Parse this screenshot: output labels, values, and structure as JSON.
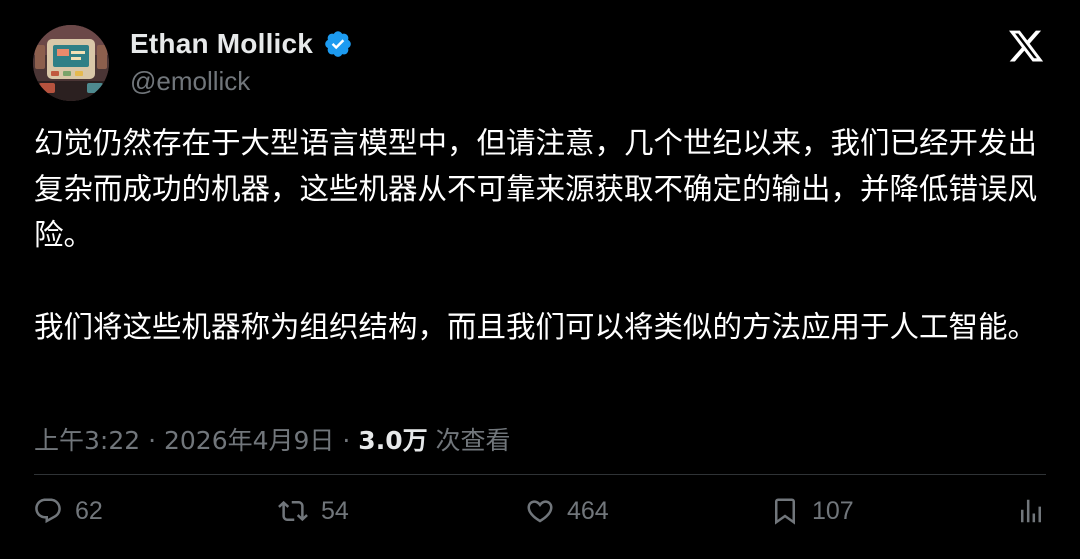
{
  "author": {
    "name": "Ethan Mollick",
    "handle": "@emollick"
  },
  "tweet": {
    "paragraphs": [
      "幻觉仍然存在于大型语言模型中，但请注意，几个世纪以来，我们已经开发出复杂而成功的机器，这些机器从不可靠来源获取不确定的输出，并降低错误风险。",
      "我们将这些机器称为组织结构，而且我们可以将类似的方法应用于人工智能。"
    ],
    "time": "上午3:22",
    "separator": "·",
    "date": "2026年4月9日",
    "views_count": "3.0万",
    "views_label": "次查看"
  },
  "actions": {
    "replies": "62",
    "reposts": "54",
    "likes": "464",
    "bookmarks": "107"
  },
  "icons": {
    "verified": "verified-badge-icon",
    "logo": "x-logo-icon",
    "reply": "reply-icon",
    "repost": "repost-icon",
    "like": "heart-icon",
    "bookmark": "bookmark-icon",
    "views": "analytics-icon"
  },
  "colors": {
    "background": "#000000",
    "text": "#ffffff",
    "secondary": "#71767b",
    "verified": "#1d9bf0",
    "divider": "#2f3336"
  }
}
